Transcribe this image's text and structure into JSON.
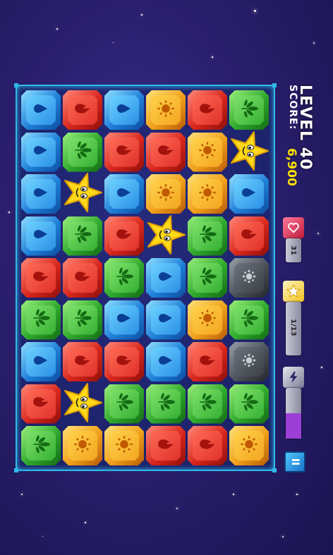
{
  "hud": {
    "level": "LEVEL 40",
    "score_label": "SCORE:",
    "score_value": "6,900",
    "hearts_text": "31",
    "stars_text": "1/13",
    "power_fill_fraction": 0.5,
    "pause_icon": "pause-icon"
  },
  "colors": {
    "blue": "#2a8fe6",
    "red": "#e0302a",
    "green": "#34b033",
    "yellow": "#f4a520",
    "gray": "#4b5058",
    "board_border": "#2fb8e8",
    "score_value": "#ffe100",
    "power_fill": "#9b3fd6"
  },
  "icons": {
    "blue": "water-drop-icon",
    "red": "fire-icon",
    "green": "leaf-icon",
    "yellow": "sun-icon",
    "gray": "orb-icon",
    "star": "smiling-star-icon",
    "heart": "heart-icon",
    "star_meter": "star-icon",
    "lightning": "lightning-icon"
  },
  "board": {
    "rows": [
      [
        "blue",
        "red",
        "blue",
        "yellow",
        "red",
        "green"
      ],
      [
        "blue",
        "green",
        "red",
        "red",
        "yellow",
        "star"
      ],
      [
        "blue",
        "star",
        "blue",
        "yellow",
        "yellow",
        "blue"
      ],
      [
        "blue",
        "green",
        "red",
        "star",
        "green",
        "red"
      ],
      [
        "red",
        "red",
        "green",
        "blue",
        "green",
        "gray"
      ],
      [
        "green",
        "green",
        "blue",
        "blue",
        "yellow",
        "green"
      ],
      [
        "blue",
        "red",
        "red",
        "blue",
        "red",
        "gray"
      ],
      [
        "red",
        "star",
        "green",
        "green",
        "green",
        "green"
      ],
      [
        "green",
        "yellow",
        "yellow",
        "red",
        "red",
        "yellow"
      ]
    ]
  }
}
